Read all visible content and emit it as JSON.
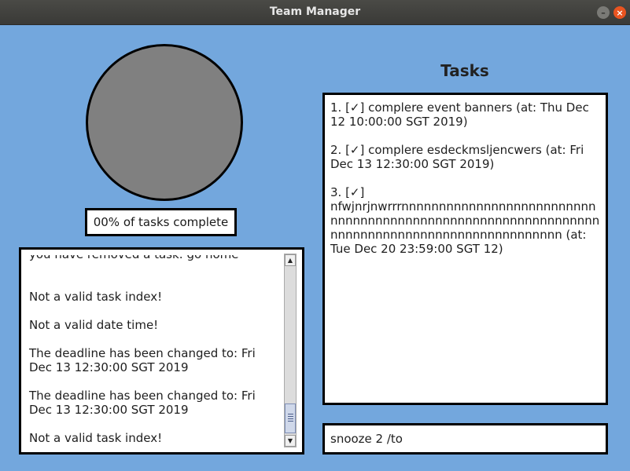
{
  "window": {
    "title": "Team Manager",
    "minimize_glyph": "–",
    "close_glyph": "×"
  },
  "progress": {
    "percent_complete": 0,
    "label": "00% of tasks complete"
  },
  "avatar": {
    "fill_color": "#808080"
  },
  "log": {
    "messages": [
      "you have removed a task: go home",
      "Not a valid task index!",
      "Not a valid date time!",
      "The deadline has been changed to: Fri Dec 13 12:30:00 SGT 2019",
      "The deadline has been changed to: Fri Dec 13 12:30:00 SGT 2019",
      "Not a valid task index!"
    ],
    "scroll_position": 0.85
  },
  "tasks": {
    "title": "Tasks",
    "items": [
      "1. [✓] complere event banners (at: Thu Dec 12 10:00:00 SGT 2019)",
      "2. [✓] complere esdeckmsljencwers (at: Fri Dec 13 12:30:00 SGT 2019)",
      "3. [✓] nfwjnrjnwrrrnnnnnnnnnnnnnnnnnnnnnnnnnnnnnnnnnnnnnnnnnnnnnnnnnnnnnnnnnnnnnnnnnnnnnnnnnnnnnnnnnnnnnnnnnnnnn (at: Tue Dec 20 23:59:00 SGT 12)"
    ]
  },
  "command": {
    "value": "snooze 2 /to"
  },
  "colors": {
    "background": "#73a7dd",
    "titlebar": "#3c3c39",
    "close_button": "#e95420",
    "panel_border": "#000000"
  }
}
